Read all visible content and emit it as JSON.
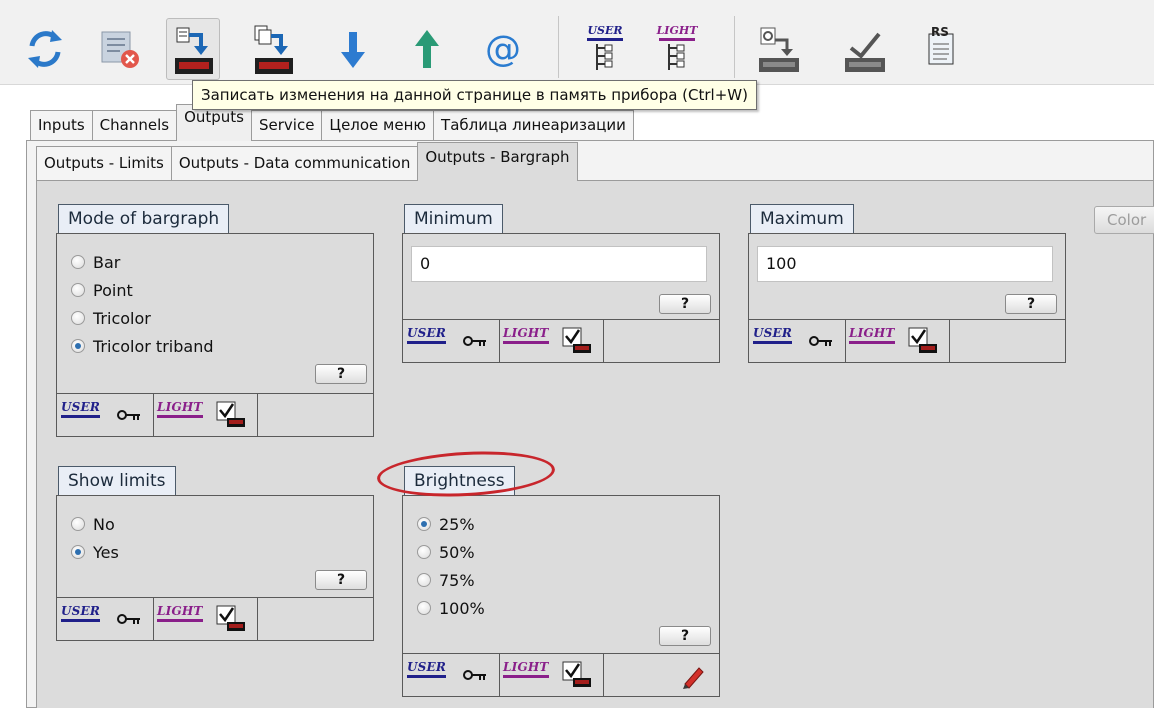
{
  "toolbar": {
    "buttons": [
      {
        "name": "refresh-icon"
      },
      {
        "name": "clear-list-icon"
      },
      {
        "name": "write-page-to-device-icon"
      },
      {
        "name": "write-all-to-device-icon"
      },
      {
        "name": "download-arrow-icon"
      },
      {
        "name": "upload-arrow-icon"
      },
      {
        "name": "email-icon"
      },
      {
        "name": "user-menu-icon",
        "label": "USER"
      },
      {
        "name": "light-menu-icon",
        "label": "LIGHT"
      },
      {
        "name": "device-config-icon"
      },
      {
        "name": "device-verify-icon"
      },
      {
        "name": "rs-document-icon",
        "label": "RS"
      }
    ]
  },
  "tooltip": "Записать изменения на данной странице в память прибора (Ctrl+W)",
  "tabs": [
    "Inputs",
    "Channels",
    "Outputs",
    "Service",
    "Целое меню",
    "Таблица линеаризации"
  ],
  "subtabs": [
    "Outputs - Limits",
    "Outputs - Data communication",
    "Outputs - Bargraph"
  ],
  "color_button": "Color",
  "mode": {
    "title": "Mode of bargraph",
    "options": [
      "Bar",
      "Point",
      "Tricolor",
      "Tricolor triband"
    ],
    "selected": "Tricolor triband"
  },
  "minimum": {
    "title": "Minimum",
    "value": "0"
  },
  "maximum": {
    "title": "Maximum",
    "value": "100"
  },
  "show_limits": {
    "title": "Show limits",
    "options": [
      "No",
      "Yes"
    ],
    "selected": "Yes"
  },
  "brightness": {
    "title": "Brightness",
    "options": [
      "25%",
      "50%",
      "75%",
      "100%"
    ],
    "selected": "25%"
  },
  "common": {
    "help": "?",
    "user_badge": "USER",
    "light_badge": "LIGHT"
  },
  "colors": {
    "accent_annotation": "#c8262c",
    "user_badge": "#20208a",
    "light_badge": "#8a1f8a"
  }
}
